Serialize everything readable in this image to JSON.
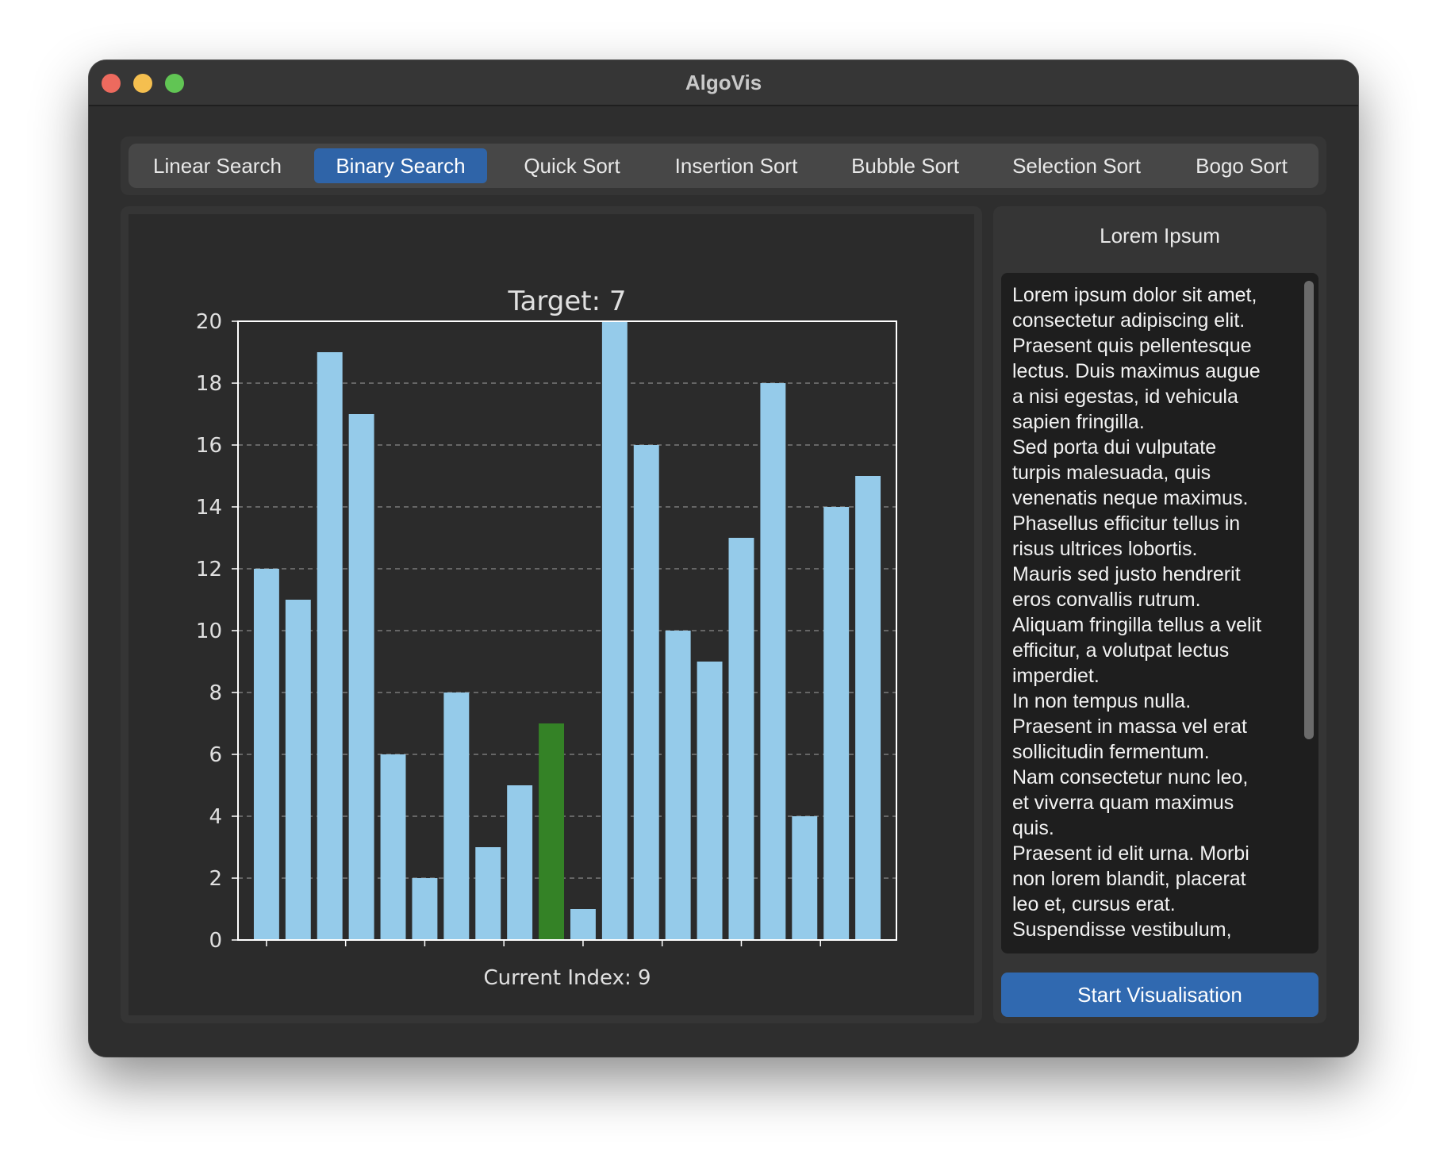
{
  "window": {
    "title": "AlgoVis"
  },
  "tabs": [
    {
      "label": "Linear Search",
      "active": false
    },
    {
      "label": "Binary Search",
      "active": true
    },
    {
      "label": "Quick Sort",
      "active": false
    },
    {
      "label": "Insertion Sort",
      "active": false
    },
    {
      "label": "Bubble Sort",
      "active": false
    },
    {
      "label": "Selection Sort",
      "active": false
    },
    {
      "label": "Bogo Sort",
      "active": false
    }
  ],
  "side_panel": {
    "title": "Lorem Ipsum",
    "text_lines": [
      "Lorem ipsum dolor sit amet,",
      "consectetur adipiscing elit.",
      "Praesent quis pellentesque",
      "lectus. Duis maximus augue",
      "a nisi egestas, id vehicula",
      "sapien fringilla.",
      "Sed porta dui vulputate",
      "turpis malesuada, quis",
      "venenatis neque maximus.",
      "Phasellus efficitur tellus in",
      "risus ultrices lobortis.",
      "Mauris sed justo hendrerit",
      "eros convallis rutrum.",
      "Aliquam fringilla tellus a velit",
      "efficitur, a volutpat lectus",
      "imperdiet.",
      "In non tempus nulla.",
      "Praesent in massa vel erat",
      "sollicitudin fermentum.",
      "Nam consectetur nunc leo,",
      "et viverra quam maximus",
      "quis.",
      "Praesent id elit urna. Morbi",
      "non lorem blandit, placerat",
      "leo et, cursus erat.",
      "Suspendisse vestibulum,"
    ],
    "button_label": "Start Visualisation"
  },
  "colors": {
    "bar": "#95cbea",
    "highlight": "#348226",
    "accent": "#2f64a8"
  },
  "chart_data": {
    "type": "bar",
    "title": "Target: 7",
    "xlabel": "Current Index: 9",
    "ylabel": "",
    "values": [
      12,
      11,
      19,
      17,
      6,
      2,
      8,
      3,
      5,
      7,
      1,
      20,
      16,
      10,
      9,
      13,
      18,
      4,
      14,
      15
    ],
    "highlight_index": 9,
    "ylim": [
      0,
      20
    ],
    "yticks": [
      0,
      2,
      4,
      6,
      8,
      10,
      12,
      14,
      16,
      18,
      20
    ],
    "grid": "horizontal dashed",
    "legend": "none"
  }
}
